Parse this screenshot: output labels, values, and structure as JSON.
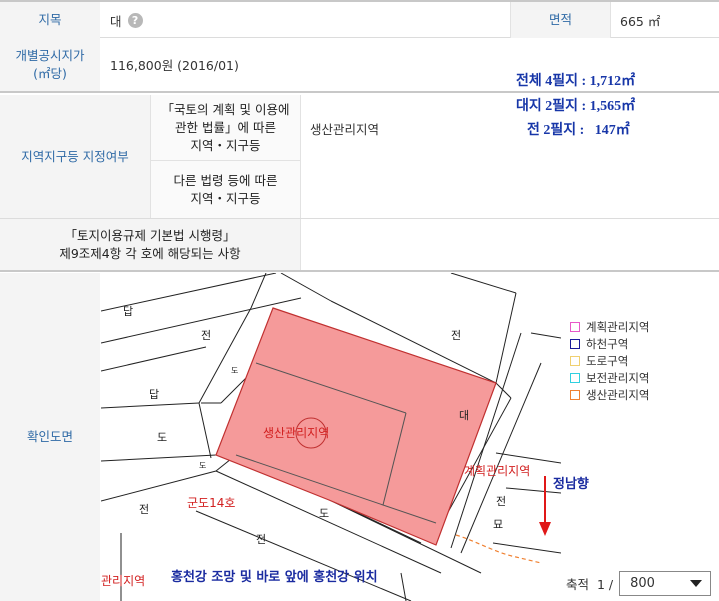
{
  "row1": {
    "label": "지목",
    "value": "대",
    "help": "?",
    "area_label": "면적",
    "area_value": "665 ㎡"
  },
  "row2": {
    "label_line1": "개별공시지가",
    "label_line2": "(㎡당)",
    "value": "116,800원 (2016/01)"
  },
  "notes": {
    "total": "전체 4필지 : 1,712㎡",
    "dae": "대지 2필지 : 1,565㎡",
    "jeon": "전 2필지 :   147㎡"
  },
  "zoning": {
    "label": "지역지구등 지정여부",
    "sub1_line1": "「국토의 계획 및 이용에",
    "sub1_line2": "관한 법률」에 따른",
    "sub1_line3": "지역・지구등",
    "sub1_value": "생산관리지역",
    "sub2_line1": "다른 법령 등에 따른",
    "sub2_line2": "지역・지구등",
    "sub2_value": ""
  },
  "enforcement": {
    "line1": "「토지이용규제 기본법 시행령」",
    "line2": "제9조제4항 각 호에 해당되는 사항",
    "value": ""
  },
  "map_section": {
    "label": "확인도면",
    "labels": {
      "dap1": "답",
      "jeon1": "전",
      "jeon2": "전",
      "dap2": "답",
      "do1": "도",
      "do2": "도",
      "do3": "도",
      "jeon3": "전",
      "dae": "대",
      "do4": "도",
      "jeon4": "전",
      "jeon5": "전",
      "myo": "묘",
      "zone_red": "생산관리지역",
      "gundo": "군도14호",
      "plan_zone": "계획관리지역",
      "bottom_zone": "관리지역"
    },
    "direction_label": "정남향",
    "caption": "홍천강 조망 및 바로 앞에 홍천강 위치"
  },
  "legend": {
    "items": [
      {
        "label": "계획관리지역",
        "color": "#e858c8"
      },
      {
        "label": "하천구역",
        "color": "#1a1a9a"
      },
      {
        "label": "도로구역",
        "color": "#f0d070"
      },
      {
        "label": "보전관리지역",
        "color": "#30d0e0"
      },
      {
        "label": "생산관리지역",
        "color": "#f08030"
      }
    ]
  },
  "scale": {
    "label": "축적  1 /",
    "value": "800"
  }
}
